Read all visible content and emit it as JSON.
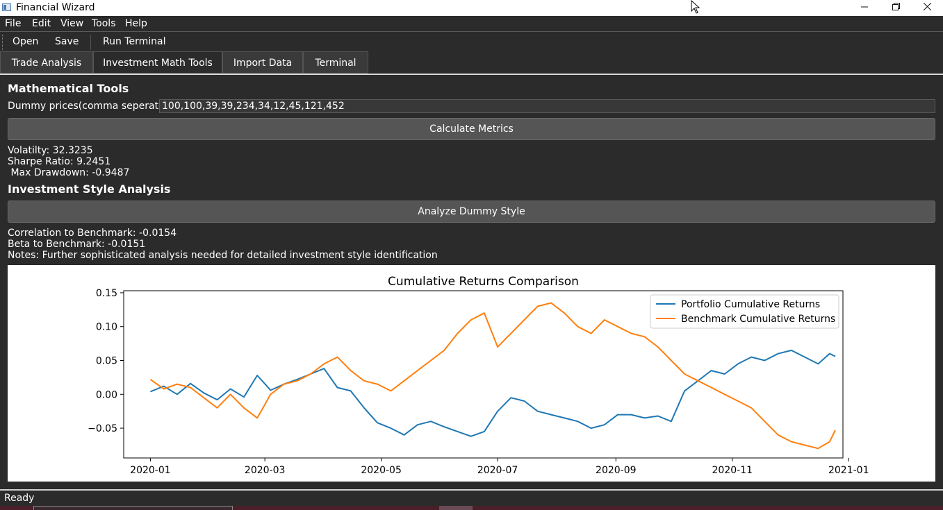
{
  "window": {
    "title": "Financial Wizard"
  },
  "menubar": [
    "File",
    "Edit",
    "View",
    "Tools",
    "Help"
  ],
  "toolbar": {
    "open_label": "Open",
    "save_label": "Save",
    "run_terminal_label": "Run Terminal"
  },
  "tabs": [
    "Trade Analysis",
    "Investment  Math Tools",
    "Import Data",
    "Terminal"
  ],
  "math_tools": {
    "title": "Mathematical Tools",
    "prices_label": "Dummy prices(comma seperated)",
    "prices_value": "100,100,39,39,234,34,12,45,121,452",
    "calculate_button": "Calculate Metrics",
    "volatility": "Volatilty: 32.3235",
    "sharpe": "Sharpe Ratio: 9.2451",
    "drawdown": " Max Drawdown: -0.9487"
  },
  "style_analysis": {
    "title": "Investment Style Analysis",
    "analyze_button": "Analyze Dummy Style",
    "correlation": "Correlation to Benchmark: -0.0154",
    "beta": "Beta to Benchmark: -0.0151",
    "notes": "Notes: Further sophisticated analysis needed for detailed investment style identification"
  },
  "status": {
    "text": "Ready"
  },
  "chart_data": {
    "type": "line",
    "title": "Cumulative Returns Comparison",
    "xlabel": "",
    "ylabel": "",
    "xlim": [
      "2019-12-18",
      "2020-12-29"
    ],
    "ylim": [
      -0.094,
      0.153
    ],
    "x_ticks": [
      "2020-01",
      "2020-03",
      "2020-05",
      "2020-07",
      "2020-09",
      "2020-11",
      "2021-01"
    ],
    "y_ticks": [
      0.15,
      0.1,
      0.05,
      0.0,
      -0.05
    ],
    "y_tick_labels": [
      "0.15",
      "0.10",
      "0.05",
      "0.00",
      "−0.05"
    ],
    "legend_position": "top-right",
    "grid": false,
    "series": [
      {
        "name": "Portfolio Cumulative Returns",
        "color": "#1f77b4",
        "points": [
          [
            "2020-01-01",
            0.004
          ],
          [
            "2020-01-08",
            0.012
          ],
          [
            "2020-01-15",
            0.0
          ],
          [
            "2020-01-22",
            0.016
          ],
          [
            "2020-01-29",
            0.002
          ],
          [
            "2020-02-05",
            -0.008
          ],
          [
            "2020-02-12",
            0.008
          ],
          [
            "2020-02-19",
            -0.004
          ],
          [
            "2020-02-26",
            0.028
          ],
          [
            "2020-03-04",
            0.006
          ],
          [
            "2020-03-11",
            0.015
          ],
          [
            "2020-03-18",
            0.022
          ],
          [
            "2020-03-25",
            0.03
          ],
          [
            "2020-04-01",
            0.038
          ],
          [
            "2020-04-08",
            0.01
          ],
          [
            "2020-04-15",
            0.005
          ],
          [
            "2020-04-22",
            -0.02
          ],
          [
            "2020-04-29",
            -0.042
          ],
          [
            "2020-05-06",
            -0.05
          ],
          [
            "2020-05-13",
            -0.06
          ],
          [
            "2020-05-20",
            -0.045
          ],
          [
            "2020-05-27",
            -0.04
          ],
          [
            "2020-06-03",
            -0.048
          ],
          [
            "2020-06-10",
            -0.055
          ],
          [
            "2020-06-17",
            -0.062
          ],
          [
            "2020-06-24",
            -0.055
          ],
          [
            "2020-07-01",
            -0.025
          ],
          [
            "2020-07-08",
            -0.005
          ],
          [
            "2020-07-15",
            -0.01
          ],
          [
            "2020-07-22",
            -0.025
          ],
          [
            "2020-07-29",
            -0.03
          ],
          [
            "2020-08-05",
            -0.035
          ],
          [
            "2020-08-12",
            -0.04
          ],
          [
            "2020-08-19",
            -0.05
          ],
          [
            "2020-08-26",
            -0.045
          ],
          [
            "2020-09-02",
            -0.03
          ],
          [
            "2020-09-09",
            -0.03
          ],
          [
            "2020-09-16",
            -0.035
          ],
          [
            "2020-09-23",
            -0.032
          ],
          [
            "2020-09-30",
            -0.04
          ],
          [
            "2020-10-07",
            0.005
          ],
          [
            "2020-10-14",
            0.02
          ],
          [
            "2020-10-21",
            0.035
          ],
          [
            "2020-10-28",
            0.03
          ],
          [
            "2020-11-04",
            0.045
          ],
          [
            "2020-11-11",
            0.055
          ],
          [
            "2020-11-18",
            0.05
          ],
          [
            "2020-11-25",
            0.06
          ],
          [
            "2020-12-02",
            0.065
          ],
          [
            "2020-12-09",
            0.055
          ],
          [
            "2020-12-16",
            0.045
          ],
          [
            "2020-12-22",
            0.06
          ],
          [
            "2020-12-25",
            0.056
          ]
        ]
      },
      {
        "name": "Benchmark Cumulative Returns",
        "color": "#ff7f0e",
        "points": [
          [
            "2020-01-01",
            0.022
          ],
          [
            "2020-01-08",
            0.008
          ],
          [
            "2020-01-15",
            0.015
          ],
          [
            "2020-01-22",
            0.01
          ],
          [
            "2020-01-29",
            -0.005
          ],
          [
            "2020-02-05",
            -0.02
          ],
          [
            "2020-02-12",
            0.0
          ],
          [
            "2020-02-19",
            -0.02
          ],
          [
            "2020-02-26",
            -0.035
          ],
          [
            "2020-03-04",
            0.0
          ],
          [
            "2020-03-11",
            0.015
          ],
          [
            "2020-03-18",
            0.02
          ],
          [
            "2020-03-25",
            0.03
          ],
          [
            "2020-04-01",
            0.045
          ],
          [
            "2020-04-08",
            0.055
          ],
          [
            "2020-04-15",
            0.035
          ],
          [
            "2020-04-22",
            0.02
          ],
          [
            "2020-04-29",
            0.015
          ],
          [
            "2020-05-06",
            0.005
          ],
          [
            "2020-05-13",
            0.02
          ],
          [
            "2020-05-20",
            0.035
          ],
          [
            "2020-05-27",
            0.05
          ],
          [
            "2020-06-03",
            0.065
          ],
          [
            "2020-06-10",
            0.09
          ],
          [
            "2020-06-17",
            0.11
          ],
          [
            "2020-06-24",
            0.12
          ],
          [
            "2020-07-01",
            0.07
          ],
          [
            "2020-07-08",
            0.09
          ],
          [
            "2020-07-15",
            0.11
          ],
          [
            "2020-07-22",
            0.13
          ],
          [
            "2020-07-29",
            0.135
          ],
          [
            "2020-08-05",
            0.12
          ],
          [
            "2020-08-12",
            0.1
          ],
          [
            "2020-08-19",
            0.09
          ],
          [
            "2020-08-26",
            0.11
          ],
          [
            "2020-09-02",
            0.1
          ],
          [
            "2020-09-09",
            0.09
          ],
          [
            "2020-09-16",
            0.085
          ],
          [
            "2020-09-23",
            0.07
          ],
          [
            "2020-09-30",
            0.05
          ],
          [
            "2020-10-07",
            0.03
          ],
          [
            "2020-10-14",
            0.02
          ],
          [
            "2020-10-21",
            0.01
          ],
          [
            "2020-10-28",
            0.0
          ],
          [
            "2020-11-04",
            -0.01
          ],
          [
            "2020-11-11",
            -0.02
          ],
          [
            "2020-11-18",
            -0.04
          ],
          [
            "2020-11-25",
            -0.06
          ],
          [
            "2020-12-02",
            -0.07
          ],
          [
            "2020-12-09",
            -0.075
          ],
          [
            "2020-12-16",
            -0.08
          ],
          [
            "2020-12-22",
            -0.07
          ],
          [
            "2020-12-25",
            -0.053
          ]
        ]
      }
    ]
  },
  "icons": {
    "app": "app-icon",
    "minimize": "minimize-icon",
    "maximize": "maximize-icon",
    "close": "close-icon"
  }
}
